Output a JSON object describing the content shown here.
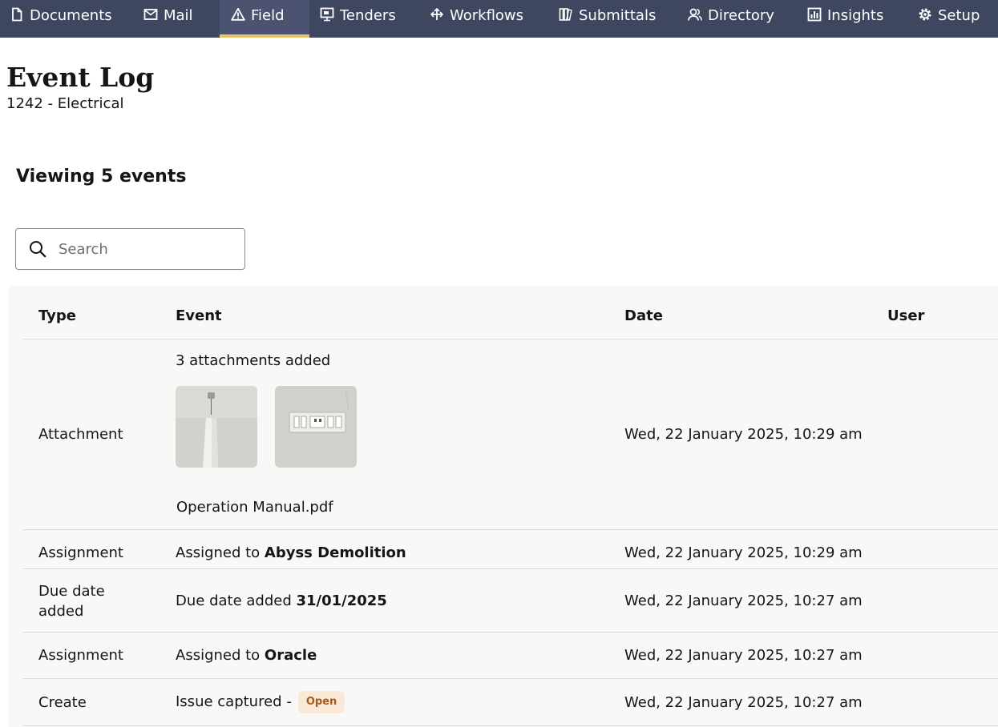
{
  "nav": {
    "items": [
      {
        "label": "Documents",
        "icon": "document-icon"
      },
      {
        "label": "Mail",
        "icon": "mail-icon"
      },
      {
        "label": "Field",
        "icon": "warning-triangle-icon",
        "active": true
      },
      {
        "label": "Tenders",
        "icon": "tenders-icon"
      },
      {
        "label": "Workflows",
        "icon": "workflows-icon"
      },
      {
        "label": "Submittals",
        "icon": "submittals-icon"
      },
      {
        "label": "Directory",
        "icon": "people-icon"
      },
      {
        "label": "Insights",
        "icon": "chart-icon"
      },
      {
        "label": "Setup",
        "icon": "gear-icon"
      }
    ],
    "active_underline_color": "#e9c46a",
    "background_color": "#3f4660"
  },
  "page": {
    "title": "Event Log",
    "subtitle": "1242 - Electrical",
    "count_heading": "Viewing 5 events"
  },
  "search": {
    "placeholder": "Search",
    "value": ""
  },
  "table": {
    "headers": {
      "type": "Type",
      "event": "Event",
      "date": "Date",
      "user": "User"
    },
    "rows": [
      {
        "type": "Attachment",
        "event_text": "3 attachments added",
        "attachments": [
          {
            "kind": "image",
            "subject": "pendant light"
          },
          {
            "kind": "image",
            "subject": "wall switch plate"
          },
          {
            "kind": "file",
            "name": "Operation Manual.pdf"
          }
        ],
        "date": "Wed, 22 January 2025, 10:29 am",
        "user": ""
      },
      {
        "type": "Assignment",
        "event_prefix": "Assigned to ",
        "event_bold": "Abyss Demolition",
        "date": "Wed, 22 January 2025, 10:29 am",
        "user": ""
      },
      {
        "type": "Due date added",
        "event_prefix": "Due date added ",
        "event_bold": "31/01/2025",
        "date": "Wed, 22 January 2025, 10:27 am",
        "user": ""
      },
      {
        "type": "Assignment",
        "event_prefix": "Assigned to ",
        "event_bold": "Oracle",
        "date": "Wed, 22 January 2025, 10:27 am",
        "user": ""
      },
      {
        "type": "Create",
        "event_prefix": "Issue captured -",
        "badge": "Open",
        "date": "Wed, 22 January 2025, 10:27 am",
        "user": ""
      }
    ]
  }
}
